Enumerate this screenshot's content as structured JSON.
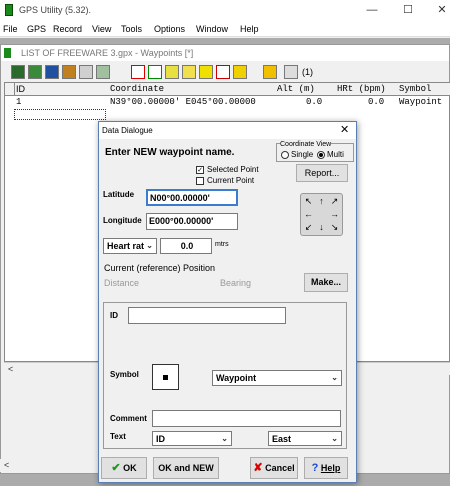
{
  "window": {
    "title": "GPS Utility (5.32).",
    "minimize": "—",
    "maximize": "☐",
    "close": "✕"
  },
  "menu": [
    "File",
    "GPS",
    "Record",
    "View",
    "Tools",
    "Options",
    "Window",
    "Help"
  ],
  "child": {
    "title": "LIST OF FREEWARE 3.gpx - Waypoints [*]",
    "counter": "(1)"
  },
  "grid": {
    "columns": [
      "ID",
      "Coordinate",
      "Alt (m)",
      "HRt (bpm)",
      "Symbol"
    ],
    "rows": [
      {
        "id": "1",
        "coordinate": "N39°00.00000' E045°00.00000",
        "alt": "0.0",
        "hrt": "0.0",
        "symbol": "Waypoint"
      }
    ]
  },
  "dialog": {
    "title": "Data Dialogue",
    "close": "✕",
    "heading": "Enter NEW waypoint name.",
    "coord_view": {
      "label": "Coordinate View",
      "single": "Single",
      "multi": "Multi"
    },
    "selected_point": "Selected Point",
    "current_point": "Current Point",
    "report_button": "Report...",
    "latitude_label": "Latitude",
    "latitude_value": "N00°00.00000'",
    "longitude_label": "Longitude",
    "longitude_value": "E000°00.00000'",
    "pad": {
      "nw": "↖",
      "n": "↑",
      "ne": "↗",
      "w": "←",
      "e": "→",
      "sw": "↙",
      "s": "↓",
      "se": "↘"
    },
    "heart_rate_select": "Heart rat",
    "heart_rate_value": "0.0",
    "heart_rate_unit": "mtrs",
    "current_ref_label": "Current (reference) Position",
    "distance_label": "Distance",
    "bearing_label": "Bearing",
    "make_button": "Make...",
    "id_label": "ID",
    "id_value": "",
    "symbol_label": "Symbol",
    "symbol_value": "Waypoint",
    "comment_label": "Comment",
    "comment_value": "",
    "text_label": "Text",
    "text_value": "ID",
    "text_position": "East",
    "ok_button": "OK",
    "ok_new_button": "OK and NEW",
    "cancel_button": "Cancel",
    "help_button": "Help"
  }
}
